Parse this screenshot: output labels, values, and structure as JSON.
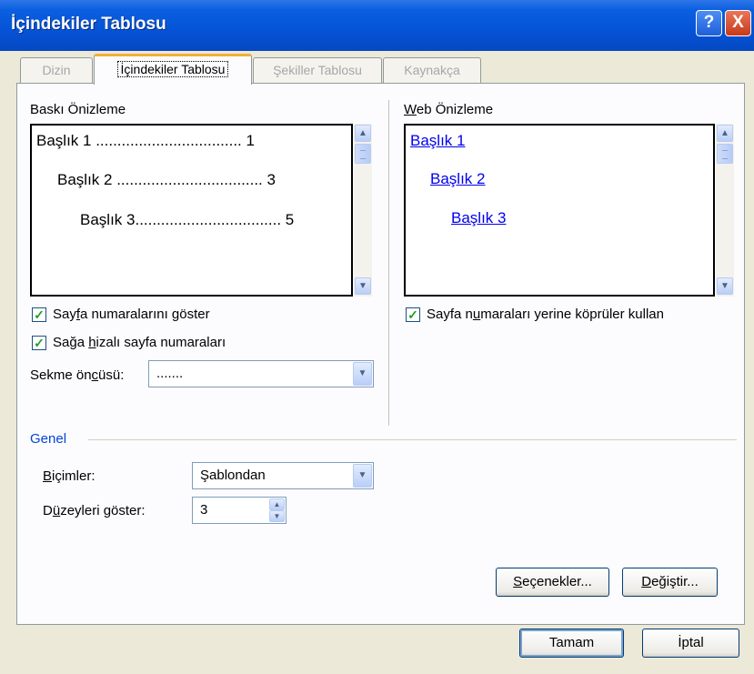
{
  "window": {
    "title": "İçindekiler Tablosu"
  },
  "title_buttons": {
    "help": "?",
    "close": "X"
  },
  "tabs": [
    {
      "label": "Dizin",
      "active": false
    },
    {
      "label": "İçindekiler Tablosu",
      "active": true
    },
    {
      "label": "Şekiller Tablosu",
      "active": false
    },
    {
      "label": "Kaynakça",
      "active": false
    }
  ],
  "print_preview": {
    "label": "Baskı Önizleme",
    "rows": [
      {
        "text": "Başlık 1 .................................. 1"
      },
      {
        "text": "Başlık 2 .................................. 3"
      },
      {
        "text": "Başlık 3.................................. 5"
      }
    ]
  },
  "web_preview": {
    "label": "Web Önizleme",
    "links": [
      "Başlık 1",
      "Başlık 2",
      "Başlık 3"
    ]
  },
  "options": {
    "show_page_numbers": {
      "label": "Sayfa numaralarını göster",
      "checked": true
    },
    "right_align": {
      "label": "Sağa hizalı sayfa numaraları",
      "checked": true
    },
    "hyperlinks": {
      "label": "Sayfa numaraları yerine köprüler kullan",
      "checked": true
    },
    "tab_leader": {
      "label": "Sekme öncüsü:",
      "value": "......."
    }
  },
  "general": {
    "title": "Genel",
    "formats_label": "Biçimler:",
    "formats_value": "Şablondan",
    "levels_label": "Düzeyleri göster:",
    "levels_value": "3"
  },
  "buttons": {
    "options": "Seçenekler...",
    "modify": "Değiştir...",
    "ok": "Tamam",
    "cancel": "İptal"
  },
  "glyphs": {
    "check": "✓",
    "up": "▲",
    "down": "▼"
  }
}
